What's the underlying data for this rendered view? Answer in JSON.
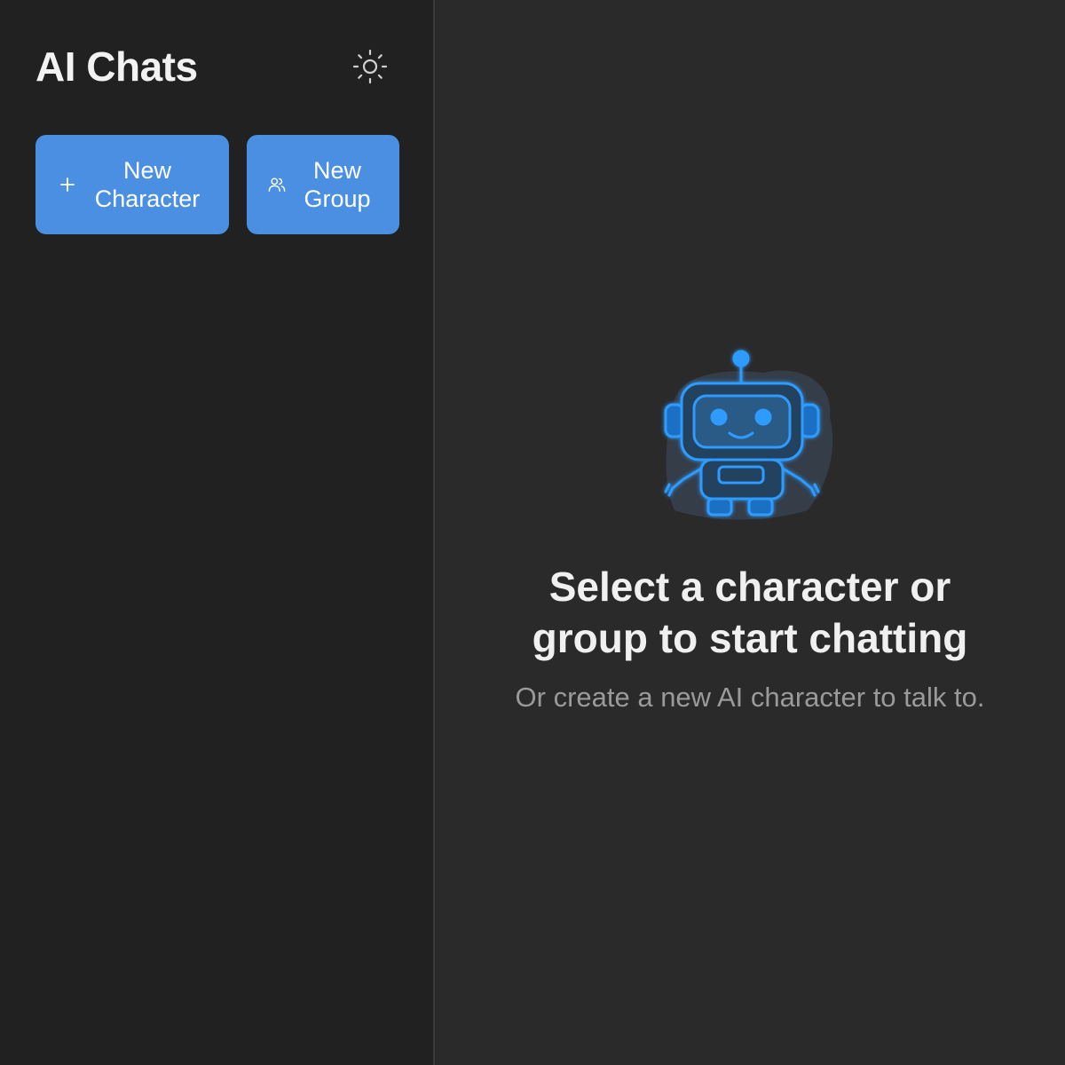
{
  "sidebar": {
    "title": "AI Chats",
    "theme_toggle_icon": "sun-icon",
    "actions": [
      {
        "label": "New\nCharacter",
        "icon": "plus-icon"
      },
      {
        "label": "New\nGroup",
        "icon": "users-icon"
      }
    ]
  },
  "main": {
    "empty_state": {
      "illustration": "robot-illustration",
      "title": "Select a character or group to start chatting",
      "subtitle": "Or create a new AI character to talk to."
    }
  },
  "colors": {
    "sidebar_bg": "#212121",
    "main_bg": "#2a2a2a",
    "accent": "#4a8fe2",
    "robot_blue": "#2f9bff"
  }
}
